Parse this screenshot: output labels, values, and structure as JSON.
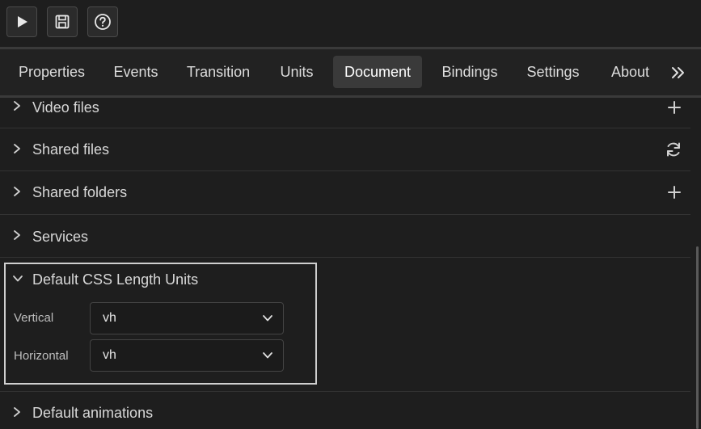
{
  "toolbar": {
    "buttons": [
      {
        "icon": "play-icon"
      },
      {
        "icon": "save-icon"
      },
      {
        "icon": "help-icon"
      }
    ]
  },
  "tabs": [
    {
      "label": "Properties",
      "active": false
    },
    {
      "label": "Events",
      "active": false
    },
    {
      "label": "Transition",
      "active": false
    },
    {
      "label": "Units",
      "active": false
    },
    {
      "label": "Document",
      "active": true
    },
    {
      "label": "Bindings",
      "active": false
    },
    {
      "label": "Settings",
      "active": false
    },
    {
      "label": "About",
      "active": false
    }
  ],
  "tabs_overflow_icon": "double-chevron-right-icon",
  "sections": {
    "video_files": {
      "title": "Video files",
      "action_icon": "plus-icon"
    },
    "shared_files": {
      "title": "Shared files",
      "action_icon": "refresh-icon"
    },
    "shared_folders": {
      "title": "Shared folders",
      "action_icon": "plus-icon"
    },
    "services": {
      "title": "Services"
    },
    "default_css_units": {
      "title": "Default CSS Length Units",
      "vertical": {
        "label": "Vertical",
        "value": "vh"
      },
      "horizontal": {
        "label": "Horizontal",
        "value": "vh"
      }
    },
    "default_animations": {
      "title": "Default animations"
    }
  },
  "colors": {
    "background": "#1e1e1e",
    "active_tab": "#3a3a3a",
    "highlight_border": "#cfcfcf"
  }
}
